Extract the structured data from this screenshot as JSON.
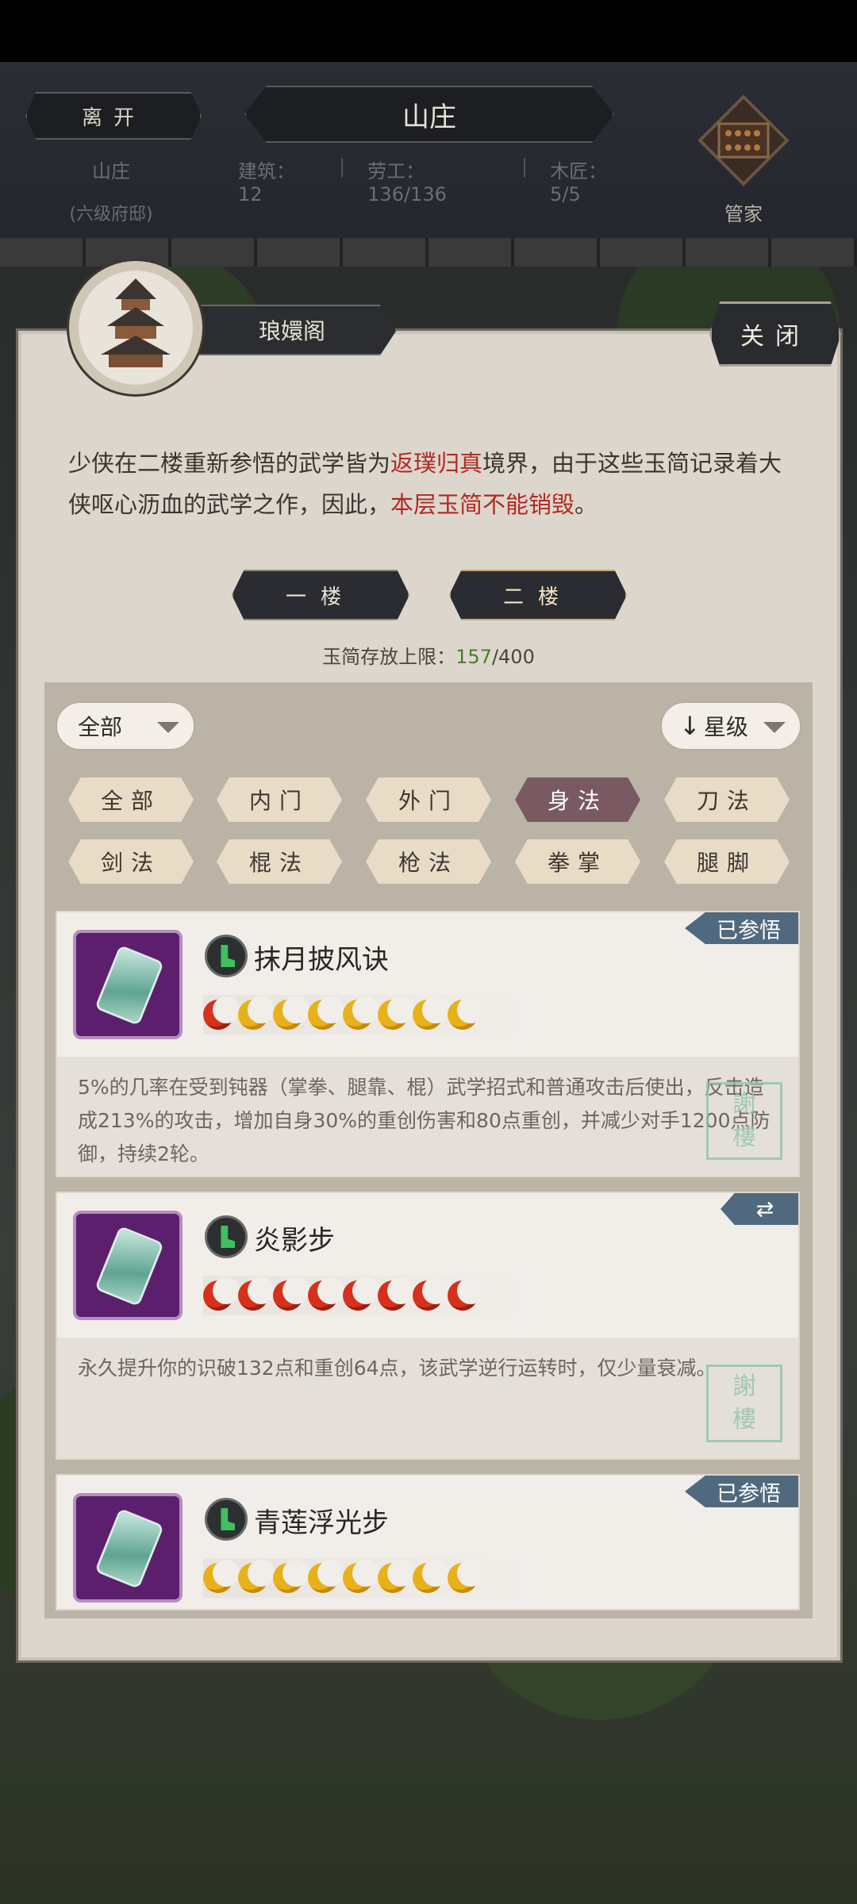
{
  "top": {
    "leave_label": "离开",
    "title": "山庄",
    "location_name": "山庄",
    "location_rank": "(六级府邸)",
    "stats": [
      {
        "label": "建筑",
        "value": "12"
      },
      {
        "label": "劳工",
        "value": "136/136"
      },
      {
        "label": "木匠",
        "value": "5/5"
      }
    ],
    "steward_label": "管家"
  },
  "panel": {
    "title": "琅嬛阁",
    "close_label": "关闭",
    "desc": {
      "p1": "少侠在二楼重新参悟的武学皆为",
      "hl1": "返璞归真",
      "p2": "境界，由于这些玉简记录着大侠呕心沥血的武学之作，因此，",
      "hl2": "本层玉简不能销毁",
      "p3": "。"
    },
    "floors": [
      "一楼",
      "二楼"
    ],
    "capacity": {
      "label": "玉简存放上限：",
      "current": "157",
      "max": "/400"
    },
    "filter_value": "全部",
    "sort_value": "星级",
    "sort_arrow": "↓",
    "categories": [
      "全部",
      "内门",
      "外门",
      "身法",
      "刀法",
      "剑法",
      "棍法",
      "枪法",
      "拳掌",
      "腿脚"
    ],
    "active_category": "身法"
  },
  "skills": [
    {
      "name": "抹月披风诀",
      "tag": "已参悟",
      "stars_red": 1,
      "stars_gold": 7,
      "description": "5%的几率在受到钝器（掌拳、腿靠、棍）武学招式和普通攻击后使出，反击造成213%的攻击，增加自身30%的重创伤害和80点重创，并减少对手1200点防御，持续2轮。"
    },
    {
      "name": "炎影步",
      "tag": "⇄",
      "stars_red": 8,
      "stars_gold": 0,
      "description": "永久提升你的识破132点和重创64点，该武学逆行运转时，仅少量衰减。"
    },
    {
      "name": "青莲浮光步",
      "tag": "已参悟",
      "stars_red": 0,
      "stars_gold": 8,
      "description": ""
    }
  ],
  "colors": {
    "highlight_red": "#b22a22",
    "count_green": "#4c7a30",
    "tag_blue": "#51697e",
    "active_chip": "#7a5a62"
  }
}
